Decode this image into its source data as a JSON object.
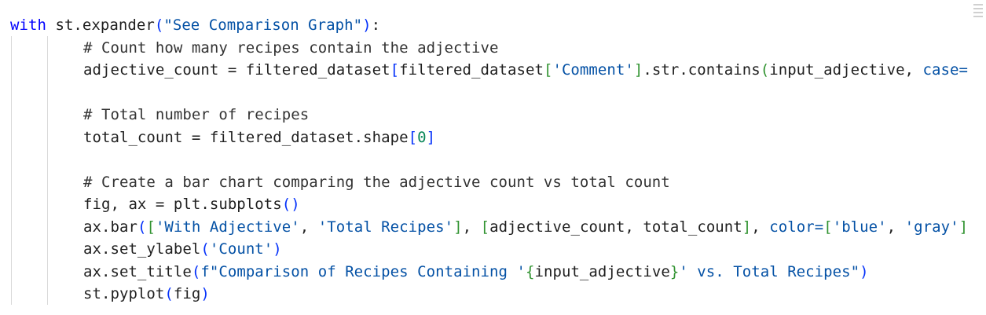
{
  "lines": [
    {
      "indent": "",
      "parts": [
        {
          "t": "with",
          "c": "kw"
        },
        {
          "t": " st.expander",
          "c": "fn"
        },
        {
          "t": "(",
          "c": "br1"
        },
        {
          "t": "\"See Comparison Graph\"",
          "c": "t-str"
        },
        {
          "t": ")",
          "c": "br1"
        },
        {
          "t": ":",
          "c": "fn"
        }
      ]
    },
    {
      "indent": "        ",
      "parts": [
        {
          "t": "# Count how many recipes contain the adjective",
          "c": "cm"
        }
      ]
    },
    {
      "indent": "        ",
      "parts": [
        {
          "t": "adjective_count = filtered_dataset",
          "c": "fn"
        },
        {
          "t": "[",
          "c": "br1"
        },
        {
          "t": "filtered_dataset",
          "c": "fn"
        },
        {
          "t": "[",
          "c": "br2"
        },
        {
          "t": "'Comment'",
          "c": "t-str"
        },
        {
          "t": "]",
          "c": "br2"
        },
        {
          "t": ".str.contains",
          "c": "fn"
        },
        {
          "t": "(",
          "c": "br2"
        },
        {
          "t": "input_adjective, ",
          "c": "fn"
        },
        {
          "t": "case=",
          "c": "t-str"
        }
      ]
    },
    {
      "indent": "",
      "parts": []
    },
    {
      "indent": "        ",
      "parts": [
        {
          "t": "# Total number of recipes",
          "c": "cm"
        }
      ]
    },
    {
      "indent": "        ",
      "parts": [
        {
          "t": "total_count = filtered_dataset.shape",
          "c": "fn"
        },
        {
          "t": "[",
          "c": "br1"
        },
        {
          "t": "0",
          "c": "num"
        },
        {
          "t": "]",
          "c": "br1"
        }
      ]
    },
    {
      "indent": "",
      "parts": []
    },
    {
      "indent": "        ",
      "parts": [
        {
          "t": "# Create a bar chart comparing the adjective count vs total count",
          "c": "cm"
        }
      ]
    },
    {
      "indent": "        ",
      "parts": [
        {
          "t": "fig, ax = plt.subplots",
          "c": "fn"
        },
        {
          "t": "()",
          "c": "br1"
        }
      ]
    },
    {
      "indent": "        ",
      "parts": [
        {
          "t": "ax.bar",
          "c": "fn"
        },
        {
          "t": "(",
          "c": "br1"
        },
        {
          "t": "[",
          "c": "br2"
        },
        {
          "t": "'With Adjective'",
          "c": "t-str"
        },
        {
          "t": ", ",
          "c": "fn"
        },
        {
          "t": "'Total Recipes'",
          "c": "t-str"
        },
        {
          "t": "]",
          "c": "br2"
        },
        {
          "t": ", ",
          "c": "fn"
        },
        {
          "t": "[",
          "c": "br2"
        },
        {
          "t": "adjective_count, total_count",
          "c": "fn"
        },
        {
          "t": "]",
          "c": "br2"
        },
        {
          "t": ", ",
          "c": "fn"
        },
        {
          "t": "color=",
          "c": "t-str"
        },
        {
          "t": "[",
          "c": "br2"
        },
        {
          "t": "'blue'",
          "c": "t-str"
        },
        {
          "t": ", ",
          "c": "fn"
        },
        {
          "t": "'gray'",
          "c": "t-str"
        },
        {
          "t": "]",
          "c": "br2"
        }
      ]
    },
    {
      "indent": "        ",
      "parts": [
        {
          "t": "ax.set_ylabel",
          "c": "fn"
        },
        {
          "t": "(",
          "c": "br1"
        },
        {
          "t": "'Count'",
          "c": "t-str"
        },
        {
          "t": ")",
          "c": "br1"
        }
      ]
    },
    {
      "indent": "        ",
      "parts": [
        {
          "t": "ax.set_title",
          "c": "fn"
        },
        {
          "t": "(",
          "c": "br1"
        },
        {
          "t": "f\"Comparison of Recipes Containing '",
          "c": "t-str"
        },
        {
          "t": "{",
          "c": "br2"
        },
        {
          "t": "input_adjective",
          "c": "fn"
        },
        {
          "t": "}",
          "c": "br2"
        },
        {
          "t": "' vs. Total Recipes\"",
          "c": "t-str"
        },
        {
          "t": ")",
          "c": "br1"
        }
      ]
    },
    {
      "indent": "        ",
      "parts": [
        {
          "t": "st.pyplot",
          "c": "fn"
        },
        {
          "t": "(",
          "c": "br1"
        },
        {
          "t": "fig",
          "c": "fn"
        },
        {
          "t": ")",
          "c": "br1"
        }
      ]
    }
  ],
  "colors": {
    "keyword": "#0000ff",
    "string": "#0451a5",
    "number": "#098658",
    "bracket_level1": "#0431fa",
    "bracket_level2": "#319331",
    "comment": "#333333",
    "text": "#1f1f1f",
    "background": "#ffffff",
    "indent_guide": "#d9d9d9"
  }
}
